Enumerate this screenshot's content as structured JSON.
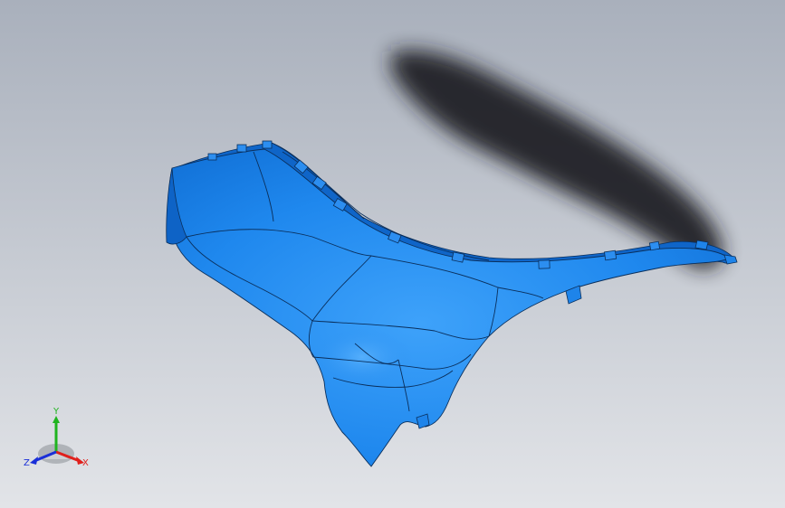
{
  "viewport": {
    "background_top": "#aab1bd",
    "background_bottom": "#e1e3e7",
    "part_color": "#1e8cf2",
    "part_dark": "#0f6bd1",
    "part_light": "#4eaaf8",
    "edge_color": "#0a2f5c",
    "shadow_color": "#1c1e22"
  },
  "triad": {
    "x_label": "X",
    "y_label": "Y",
    "z_label": "Z",
    "x_color": "#e0201c",
    "y_color": "#1fb41f",
    "z_color": "#1a2fd8"
  }
}
